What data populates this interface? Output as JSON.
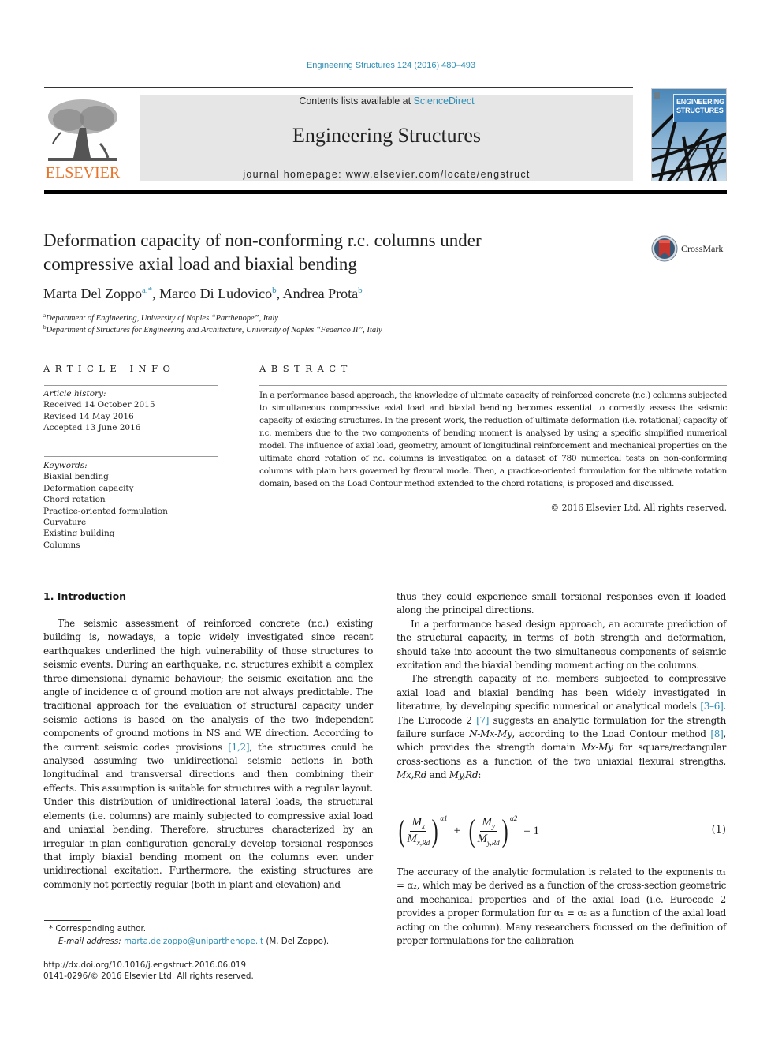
{
  "header": {
    "journal_ref": "Engineering Structures 124 (2016) 480–493",
    "contents_prefix": "Contents lists available at ",
    "contents_link": "ScienceDirect",
    "journal_name": "Engineering Structures",
    "homepage": "journal homepage: www.elsevier.com/locate/engstruct",
    "publisher_logo": "ELSEVIER",
    "cover_title_line1": "ENGINEERING",
    "cover_title_line2": "STRUCTURES",
    "crossmark_label": "CrossMark"
  },
  "article": {
    "title_line1": "Deformation capacity of non-conforming r.c. columns under",
    "title_line2": "compressive axial load and biaxial bending",
    "authors": [
      {
        "name": "Marta Del Zoppo",
        "affil": "a,*",
        "sep": ", "
      },
      {
        "name": "Marco Di Ludovico",
        "affil": "b",
        "sep": ", "
      },
      {
        "name": "Andrea Prota",
        "affil": "b",
        "sep": ""
      }
    ],
    "affiliations": [
      {
        "label": "a",
        "text": "Department of Engineering, University of Naples “Parthenope”, Italy"
      },
      {
        "label": "b",
        "text": "Department of Structures for Engineering and Architecture, University of Naples “Federico II”, Italy"
      }
    ]
  },
  "article_info": {
    "heading": "ARTICLE INFO",
    "history_label": "Article history:",
    "history": [
      "Received 14 October 2015",
      "Revised 14 May 2016",
      "Accepted 13 June 2016"
    ],
    "keywords_label": "Keywords:",
    "keywords": [
      "Biaxial bending",
      "Deformation capacity",
      "Chord rotation",
      "Practice-oriented formulation",
      "Curvature",
      "Existing building",
      "Columns"
    ]
  },
  "abstract": {
    "heading": "ABSTRACT",
    "text": "In a performance based approach, the knowledge of ultimate capacity of reinforced concrete (r.c.) columns subjected to simultaneous compressive axial load and biaxial bending becomes essential to correctly assess the seismic capacity of existing structures. In the present work, the reduction of ultimate deformation (i.e. rotational) capacity of r.c. members due to the two components of bending moment is analysed by using a specific simplified numerical model. The influence of axial load, geometry, amount of longitudinal reinforcement and mechanical properties on the ultimate chord rotation of r.c. columns is investigated on a dataset of 780 numerical tests on non-conforming columns with plain bars governed by flexural mode. Then, a practice-oriented formulation for the ultimate rotation domain, based on the Load Contour method extended to the chord rotations, is proposed and discussed.",
    "copyright": "© 2016 Elsevier Ltd. All rights reserved."
  },
  "body": {
    "section_heading": "1. Introduction",
    "left_p1_part1": "The seismic assessment of reinforced concrete (r.c.) existing building is, nowadays, a topic widely investigated since recent earthquakes underlined the high vulnerability of those structures to seismic events. During an earthquake, r.c. structures exhibit a complex three-dimensional dynamic behaviour; the seismic excitation and the angle of incidence α of ground motion are not always predictable. The traditional approach for the evaluation of structural capacity under seismic actions is based on the analysis of the two independent components of ground motions in NS and WE direction. According to the current seismic codes provisions ",
    "left_p1_cite": "[1,2]",
    "left_p1_part2": ", the structures could be analysed assuming two unidirectional seismic actions in both longitudinal and transversal directions and then combining their effects. This assumption is suitable for structures with a regular layout. Under this distribution of unidirectional lateral loads, the structural elements (i.e. columns) are mainly subjected to compressive axial load and uniaxial bending. Therefore, structures characterized by an irregular in-plan configuration generally develop torsional responses that imply biaxial bending moment on the columns even under unidirectional excitation. Furthermore, the existing structures are commonly not perfectly regular (both in plant and elevation) and",
    "right_p0": "thus they could experience small torsional responses even if loaded along the principal directions.",
    "right_p1": "In a performance based design approach, an accurate prediction of the structural capacity, in terms of both strength and deformation, should take into account the two simultaneous components of seismic excitation and the biaxial bending moment acting on the columns.",
    "right_p2_a": "The strength capacity of r.c. members subjected to compressive axial load and biaxial bending has been widely investigated in literature, by developing specific numerical or analytical models ",
    "right_p2_cite1": "[3–6]",
    "right_p2_b": ". The Eurocode 2 ",
    "right_p2_cite2": "[7]",
    "right_p2_c": " suggests an analytic formulation for the strength failure surface ",
    "right_p2_math1": "N-Mx-My",
    "right_p2_d": ", according to the Load Contour method ",
    "right_p2_cite3": "[8]",
    "right_p2_e": ", which provides the strength domain ",
    "right_p2_math2": "Mx-My",
    "right_p2_f": " for square/rectangular cross-sections as a function of the two uniaxial flexural strengths, ",
    "right_p2_math3": "Mx,Rd",
    "right_p2_g": " and ",
    "right_p2_math4": "My,Rd",
    "right_p2_h": ":",
    "equation": {
      "num1": "M",
      "num1_sub": "x",
      "den1": "M",
      "den1_sub": "x,Rd",
      "exp1": "α1",
      "plus": "+",
      "num2": "M",
      "num2_sub": "y",
      "den2": "M",
      "den2_sub": "y,Rd",
      "exp2": "α2",
      "rhs": "= 1",
      "number": "(1)"
    },
    "right_p3": "The accuracy of the analytic formulation is related to the exponents α₁ = α₂, which may be derived as a function of the cross-section geometric and mechanical properties and of the axial load (i.e. Eurocode 2 provides a proper formulation for α₁ = α₂ as a function of the axial load acting on the column). Many researchers focussed on the definition of proper formulations for the calibration"
  },
  "footnotes": {
    "corresponding": "* Corresponding author.",
    "email_label": "E-mail address: ",
    "email": "marta.delzoppo@uniparthenope.it",
    "email_suffix": " (M. Del Zoppo).",
    "doi": "http://dx.doi.org/10.1016/j.engstruct.2016.06.019",
    "issn": "0141-0296/© 2016 Elsevier Ltd. All rights reserved."
  }
}
